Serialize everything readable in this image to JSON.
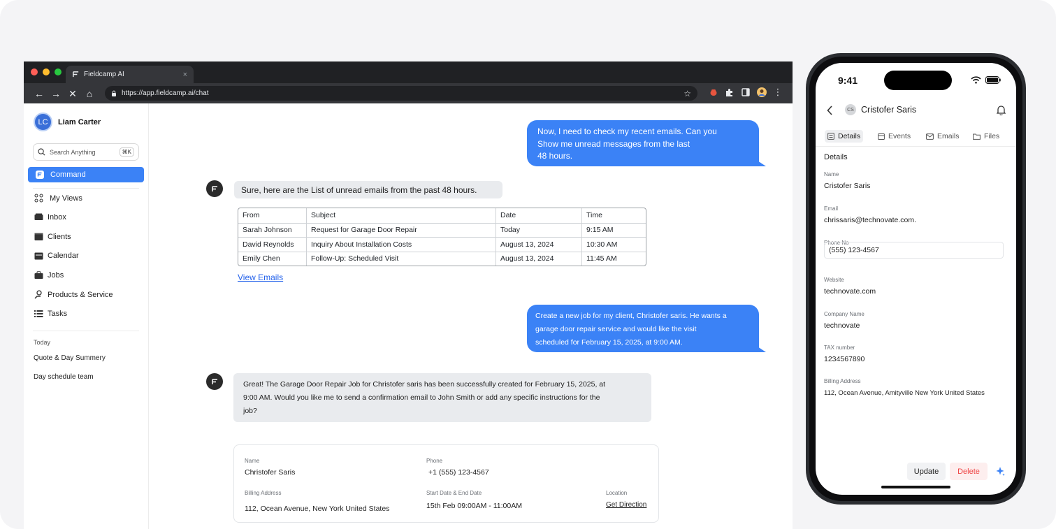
{
  "browser": {
    "tab_title": "Fieldcamp AI",
    "url": "https://app.fieldcamp.ai/chat",
    "traffic_lights": [
      "#ff5f57",
      "#febc2e",
      "#28c840"
    ]
  },
  "sidebar": {
    "user": {
      "initials": "LC",
      "name": "Liam Carter"
    },
    "search": {
      "placeholder": "Search Anything",
      "shortcut": "⌘K"
    },
    "command_label": "Command",
    "nav": [
      {
        "label": "My Views",
        "icon": "grid-icon"
      },
      {
        "label": "Inbox",
        "icon": "inbox-icon"
      },
      {
        "label": "Clients",
        "icon": "clients-icon"
      },
      {
        "label": "Calendar",
        "icon": "calendar-icon"
      },
      {
        "label": "Jobs",
        "icon": "briefcase-icon"
      },
      {
        "label": "Products & Service",
        "icon": "products-icon"
      },
      {
        "label": "Tasks",
        "icon": "tasks-icon"
      }
    ],
    "history_heading": "Today",
    "history": [
      "Quote & Day Summery",
      "Day schedule team"
    ]
  },
  "chat": {
    "msg1_user": "Now, I need to check my recent emails. Can you\nShow me unread messages from the last\n48 hours.",
    "msg2_bot": "Sure, here are the List of unread emails from the past 48 hours.",
    "email_table": {
      "headers": [
        "From",
        "Subject",
        "Date",
        "Time"
      ],
      "rows": [
        [
          "Sarah Johnson",
          "Request for Garage Door Repair",
          "Today",
          "9:15 AM"
        ],
        [
          "David Reynolds",
          "Inquiry About Installation Costs",
          "August 13, 2024",
          "10:30 AM"
        ],
        [
          "Emily Chen",
          "Follow-Up: Scheduled Visit",
          "August 13, 2024",
          "11:45 AM"
        ]
      ]
    },
    "view_emails": "View Emails",
    "msg3_user": "Create a new job for my client, Christofer saris. He wants a\ngarage door repair service and would like the visit\nscheduled for February 15, 2025, at 9:00 AM.",
    "msg4_bot": "Great! The Garage Door Repair Job for Christofer saris has been successfully created for February 15, 2025, at\n9:00 AM. Would you like me to send a confirmation email to John Smith or add any specific instructions for the\njob?",
    "job_card": {
      "name_label": "Name",
      "name": "Christofer Saris",
      "phone_label": "Phone",
      "phone": "+1 (555) 123-4567",
      "billing_label": "Billing Address",
      "billing": "112, Ocean Avenue, New York United States",
      "dates_label": "Start Date & End Date",
      "dates": "15th Feb 09:00AM - 11:00AM",
      "location_label": "Location",
      "location_link": "Get Direction"
    }
  },
  "phone": {
    "time": "9:41",
    "contact_initials": "CS",
    "contact_name": "Cristofer Saris",
    "tabs": [
      "Details",
      "Events",
      "Emails",
      "Files"
    ],
    "section_title": "Details",
    "fields": {
      "name_label": "Name",
      "name": "Cristofer Saris",
      "email_label": "Email",
      "email": "chrissaris@technovate.com.",
      "phone_label": "Phone No",
      "phone": "(555) 123-4567",
      "website_label": "Website",
      "website": "technovate.com",
      "company_label": "Company Name",
      "company": "technovate",
      "tax_label": "TAX number",
      "tax": "1234567890",
      "billing_label": "Billing Address",
      "billing": "112, Ocean Avenue, Amityville New York United States"
    },
    "update_label": "Update",
    "delete_label": "Delete"
  },
  "colors": {
    "accent": "#3b82f6",
    "danger": "#ef4444",
    "link": "#2563eb"
  }
}
